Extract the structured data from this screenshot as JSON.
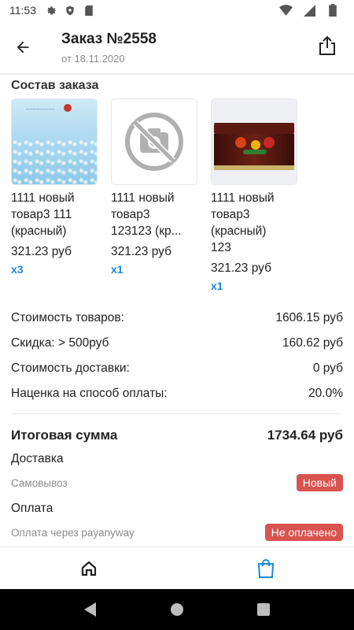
{
  "status_bar": {
    "time": "11:53"
  },
  "header": {
    "title": "Заказ №2558",
    "subtitle": "от 18.11.2020"
  },
  "section_title": "Состав заказа",
  "products": [
    {
      "name": "1111 новый\nтовар3 111\n(красный)",
      "price": "321.23 руб",
      "qty": "x3",
      "image": "card-image"
    },
    {
      "name": "1111 новый\nтовар3\n123123 (кр...",
      "price": "321.23 руб",
      "qty": "x1",
      "image": "no-photo-icon"
    },
    {
      "name": "1111 новый\nтовар3\n(красный)\n123",
      "price": "321.23 руб",
      "qty": "x1",
      "image": "box-image"
    }
  ],
  "summary": {
    "goods_label": "Стоимость товаров:",
    "goods_value": "1606.15 руб",
    "discount_label": "Скидка: > 500руб",
    "discount_value": "160.62 руб",
    "delivery_cost_label": "Стоимость доставки:",
    "delivery_cost_value": "0 руб",
    "payment_markup_label": "Наценка на способ оплаты:",
    "payment_markup_value": "20.0%"
  },
  "total": {
    "label": "Итоговая сумма",
    "value": "1734.64 руб"
  },
  "delivery": {
    "label": "Доставка",
    "method": "Самовывоз",
    "status": "Новый"
  },
  "payment": {
    "label": "Оплата",
    "method": "Оплата через payanyway",
    "status": "Не оплачено"
  },
  "colors": {
    "accent": "#1e88d4",
    "badge": "#d9534f"
  },
  "bottom_nav": [
    {
      "icon": "home-icon"
    },
    {
      "icon": "shopping-bag-icon"
    }
  ]
}
